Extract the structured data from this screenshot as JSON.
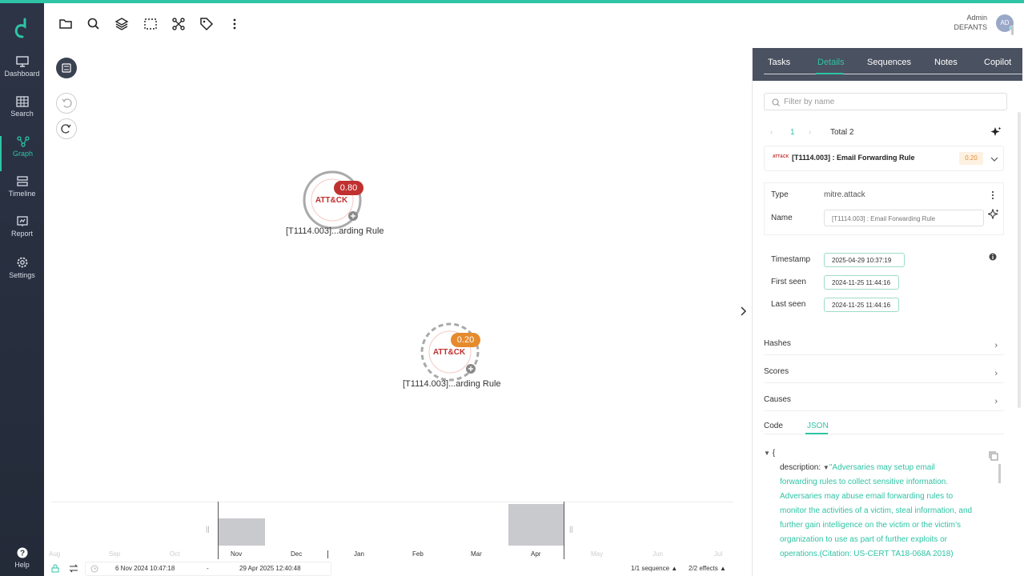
{
  "user": {
    "name": "Admin",
    "org": "DEFANTS",
    "initials": "AD"
  },
  "nav": [
    {
      "label": "Dashboard",
      "icon": "monitor-icon"
    },
    {
      "label": "Search",
      "icon": "grid-icon"
    },
    {
      "label": "Graph",
      "icon": "graph-icon",
      "active": true
    },
    {
      "label": "Timeline",
      "icon": "timeline-icon"
    },
    {
      "label": "Report",
      "icon": "report-icon"
    },
    {
      "label": "Settings",
      "icon": "gear-icon"
    },
    {
      "label": "Help",
      "icon": "help-icon"
    }
  ],
  "graph": {
    "nodes": [
      {
        "logo": "ATT&CK",
        "score": "0.80",
        "label": "[T1114.003]...arding Rule",
        "color": "#c0302f"
      },
      {
        "logo": "ATT&CK",
        "score": "0.20",
        "label": "[T1114.003]...arding Rule",
        "color": "#e68a2e"
      }
    ]
  },
  "panel": {
    "tabs": [
      "Tasks",
      "Details",
      "Sequences",
      "Notes",
      "Copilot"
    ],
    "active_tab": "Details",
    "filter_placeholder": "Filter by name",
    "pagination": {
      "page": "1",
      "total": "Total 2"
    },
    "entity": {
      "title": "[T1114.003] : Email Forwarding Rule",
      "score": "0.20"
    },
    "type_label": "Type",
    "type_value": "mitre.attack",
    "name_label": "Name",
    "name_value": "[T1114.003] : Email Forwarding Rule",
    "timestamp_label": "Timestamp",
    "timestamp_value": "2025-04-29 10:37:19",
    "first_seen_label": "First seen",
    "first_seen_value": "2024-11-25 11:44:16",
    "last_seen_label": "Last seen",
    "last_seen_value": "2024-11-25 11:44:16",
    "sections": [
      "Hashes",
      "Scores",
      "Causes"
    ],
    "code_tabs": [
      "Code",
      "JSON"
    ],
    "active_code_tab": "JSON",
    "json_open": "{",
    "json_key": "description:",
    "json_lines": [
      "\"Adversaries may setup email",
      "forwarding rules to collect sensitive information.",
      "Adversaries may abuse email forwarding rules to",
      "monitor the activities of a victim, steal information, and",
      "further gain intelligence on the victim or the victim’s",
      "organization to use as part of further exploits or",
      "operations.(Citation: US-CERT TA18-068A 2018)"
    ]
  },
  "timeline": {
    "months": [
      "Aug",
      "Sep",
      "Oct",
      "Nov",
      "Dec",
      "Jan",
      "Feb",
      "Mar",
      "Apr",
      "May",
      "Jun",
      "Jul"
    ],
    "start": "6 Nov 2024 10:47:18",
    "separator": "-",
    "end": "29 Apr 2025 12:40:48",
    "sequence": "1/1 sequence",
    "effects": "2/2 effects"
  }
}
